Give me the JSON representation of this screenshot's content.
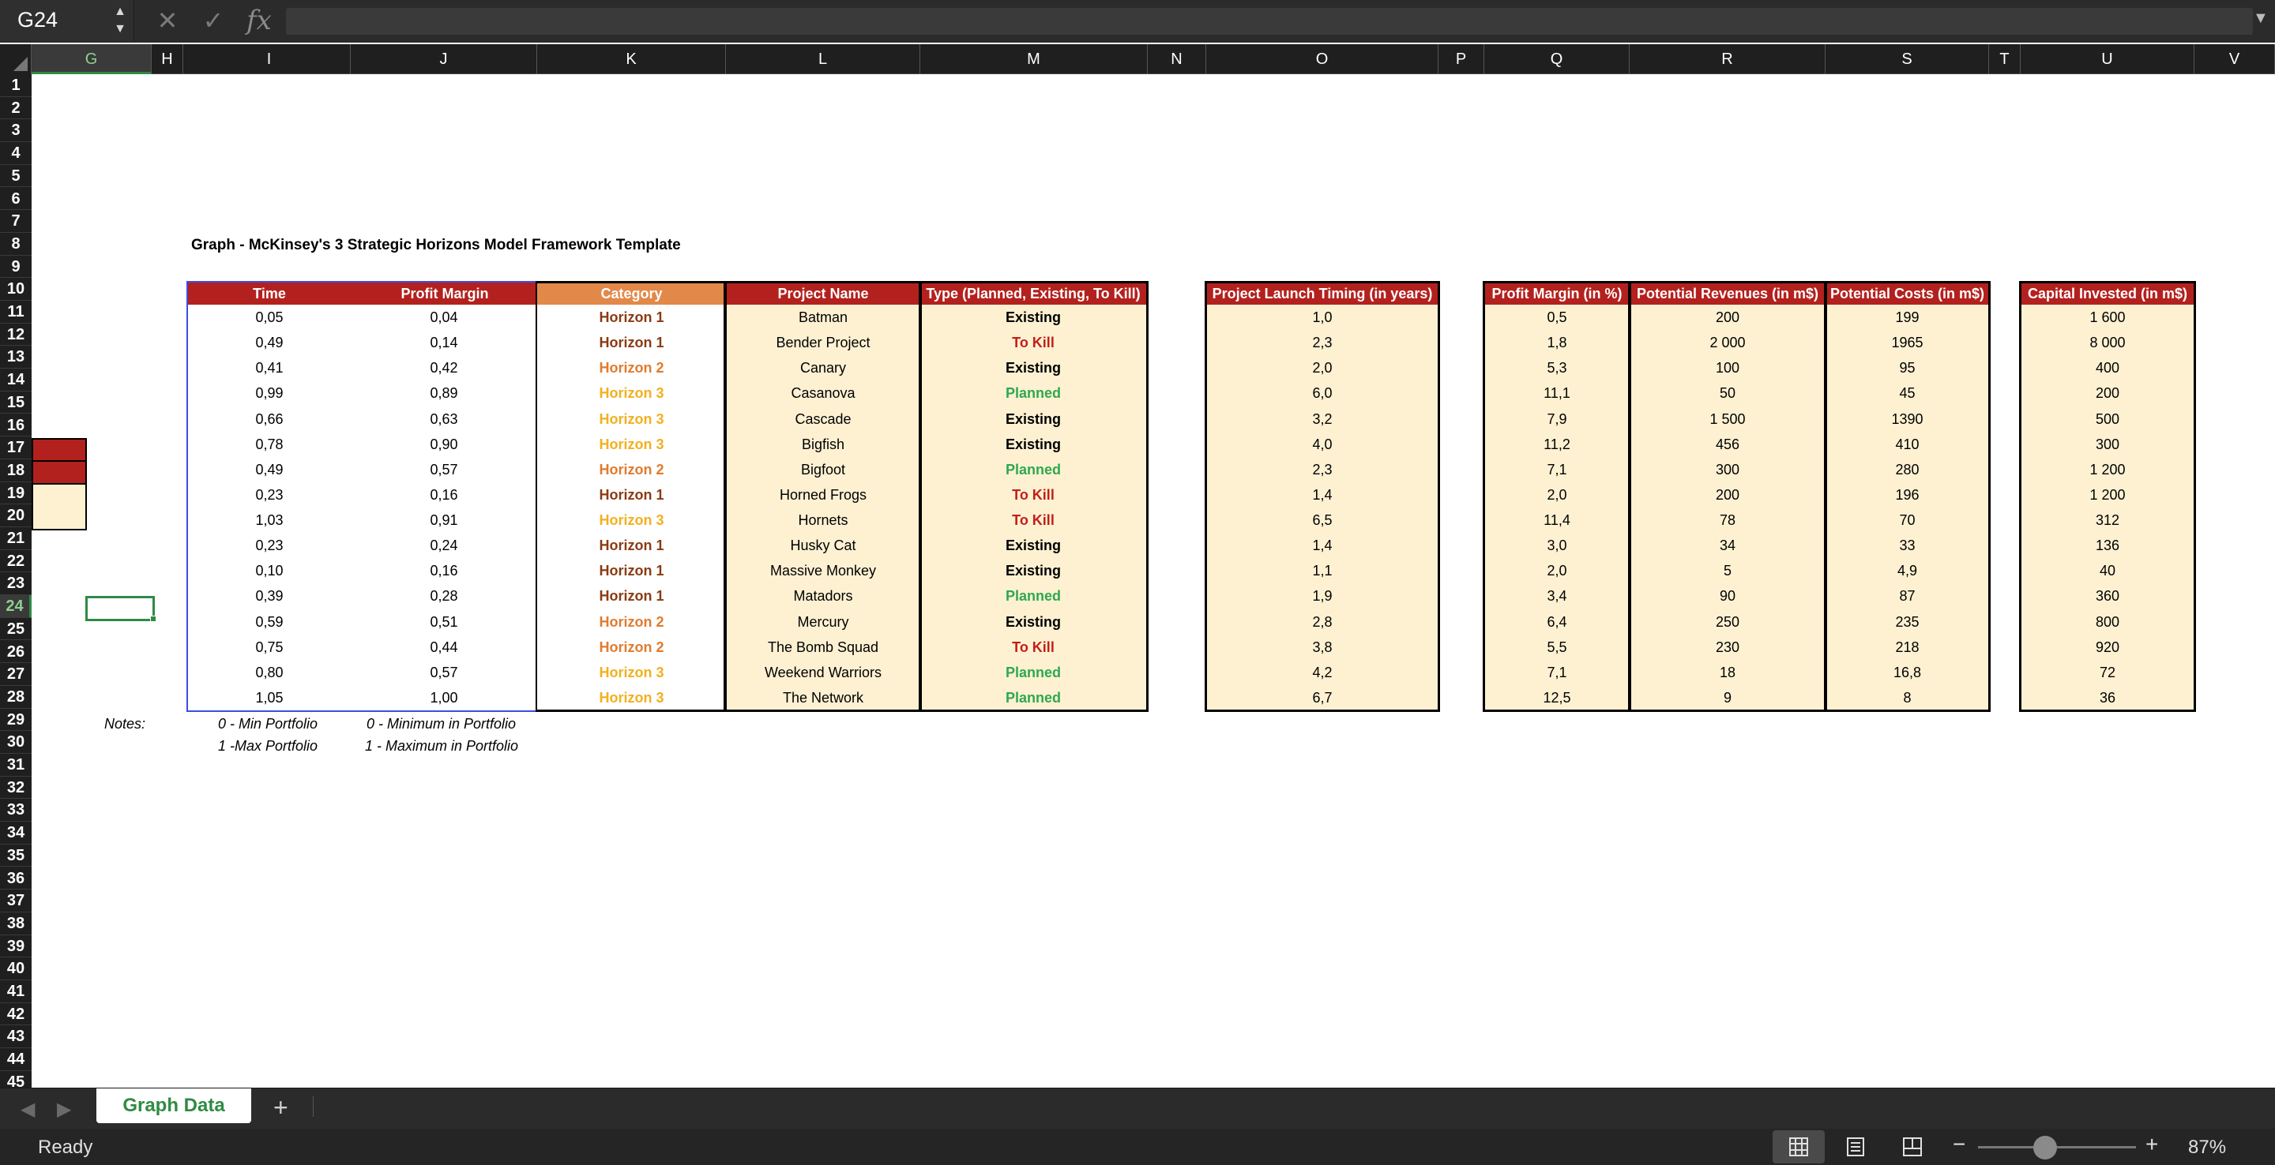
{
  "namebox": "G24",
  "formula": "",
  "colors": {
    "header_red": "#b3211e",
    "header_orange": "#e2894a",
    "beige": "#fdf1d2",
    "h1": "#8b3a12",
    "h2": "#e07b2e",
    "h3": "#f2b01e",
    "existing": "#000000",
    "tokill": "#c0201a",
    "planned": "#2fa84f",
    "accent_green": "#2f8a43"
  },
  "columns": [
    "G",
    "H",
    "I",
    "J",
    "K",
    "L",
    "M",
    "N",
    "O",
    "P",
    "Q",
    "R",
    "S",
    "T",
    "U",
    "V"
  ],
  "rows": [
    "1",
    "2",
    "3",
    "4",
    "5",
    "6",
    "7",
    "8",
    "9",
    "10",
    "11",
    "12",
    "13",
    "14",
    "15",
    "16",
    "17",
    "18",
    "19",
    "20",
    "21",
    "22",
    "23",
    "24",
    "25",
    "26",
    "27",
    "28",
    "29",
    "30",
    "31",
    "32",
    "33",
    "34",
    "35",
    "36",
    "37",
    "38",
    "39",
    "40",
    "41",
    "42",
    "43",
    "44",
    "45"
  ],
  "title": "Graph - McKinsey's 3 Strategic Horizons Model Framework Template",
  "headers": {
    "time": "Time",
    "profit_margin": "Profit Margin",
    "category": "Category",
    "project_name": "Project Name",
    "type": "Type (Planned, Existing, To Kill)",
    "launch": "Project Launch Timing (in years)",
    "pm_pct": "Profit Margin (in %)",
    "revenues": "Potential Revenues (in m$)",
    "costs": "Potential Costs (in m$)",
    "capital": "Capital Invested (in m$)"
  },
  "table": [
    {
      "time": "0,05",
      "pm": "0,04",
      "category": "Horizon 1",
      "cat": "h1",
      "name": "Batman",
      "type": "Existing",
      "tk": "existing",
      "launch": "1,0",
      "pmpct": "0,5",
      "rev": "200",
      "cost": "199",
      "cap": "1 600"
    },
    {
      "time": "0,49",
      "pm": "0,14",
      "category": "Horizon 1",
      "cat": "h1",
      "name": "Bender Project",
      "type": "To Kill",
      "tk": "tokill",
      "launch": "2,3",
      "pmpct": "1,8",
      "rev": "2 000",
      "cost": "1965",
      "cap": "8 000"
    },
    {
      "time": "0,41",
      "pm": "0,42",
      "category": "Horizon 2",
      "cat": "h2",
      "name": "Canary",
      "type": "Existing",
      "tk": "existing",
      "launch": "2,0",
      "pmpct": "5,3",
      "rev": "100",
      "cost": "95",
      "cap": "400"
    },
    {
      "time": "0,99",
      "pm": "0,89",
      "category": "Horizon 3",
      "cat": "h3",
      "name": "Casanova",
      "type": "Planned",
      "tk": "planned",
      "launch": "6,0",
      "pmpct": "11,1",
      "rev": "50",
      "cost": "45",
      "cap": "200"
    },
    {
      "time": "0,66",
      "pm": "0,63",
      "category": "Horizon 3",
      "cat": "h3",
      "name": "Cascade",
      "type": "Existing",
      "tk": "existing",
      "launch": "3,2",
      "pmpct": "7,9",
      "rev": "1 500",
      "cost": "1390",
      "cap": "500"
    },
    {
      "time": "0,78",
      "pm": "0,90",
      "category": "Horizon 3",
      "cat": "h3",
      "name": "Bigfish",
      "type": "Existing",
      "tk": "existing",
      "launch": "4,0",
      "pmpct": "11,2",
      "rev": "456",
      "cost": "410",
      "cap": "300"
    },
    {
      "time": "0,49",
      "pm": "0,57",
      "category": "Horizon 2",
      "cat": "h2",
      "name": "Bigfoot",
      "type": "Planned",
      "tk": "planned",
      "launch": "2,3",
      "pmpct": "7,1",
      "rev": "300",
      "cost": "280",
      "cap": "1 200"
    },
    {
      "time": "0,23",
      "pm": "0,16",
      "category": "Horizon 1",
      "cat": "h1",
      "name": "Horned Frogs",
      "type": "To Kill",
      "tk": "tokill",
      "launch": "1,4",
      "pmpct": "2,0",
      "rev": "200",
      "cost": "196",
      "cap": "1 200"
    },
    {
      "time": "1,03",
      "pm": "0,91",
      "category": "Horizon 3",
      "cat": "h3",
      "name": "Hornets",
      "type": "To Kill",
      "tk": "tokill",
      "launch": "6,5",
      "pmpct": "11,4",
      "rev": "78",
      "cost": "70",
      "cap": "312"
    },
    {
      "time": "0,23",
      "pm": "0,24",
      "category": "Horizon 1",
      "cat": "h1",
      "name": "Husky Cat",
      "type": "Existing",
      "tk": "existing",
      "launch": "1,4",
      "pmpct": "3,0",
      "rev": "34",
      "cost": "33",
      "cap": "136"
    },
    {
      "time": "0,10",
      "pm": "0,16",
      "category": "Horizon 1",
      "cat": "h1",
      "name": "Massive Monkey",
      "type": "Existing",
      "tk": "existing",
      "launch": "1,1",
      "pmpct": "2,0",
      "rev": "5",
      "cost": "4,9",
      "cap": "40"
    },
    {
      "time": "0,39",
      "pm": "0,28",
      "category": "Horizon 1",
      "cat": "h1",
      "name": "Matadors",
      "type": "Planned",
      "tk": "planned",
      "launch": "1,9",
      "pmpct": "3,4",
      "rev": "90",
      "cost": "87",
      "cap": "360"
    },
    {
      "time": "0,59",
      "pm": "0,51",
      "category": "Horizon 2",
      "cat": "h2",
      "name": "Mercury",
      "type": "Existing",
      "tk": "existing",
      "launch": "2,8",
      "pmpct": "6,4",
      "rev": "250",
      "cost": "235",
      "cap": "800"
    },
    {
      "time": "0,75",
      "pm": "0,44",
      "category": "Horizon 2",
      "cat": "h2",
      "name": "The Bomb Squad",
      "type": "To Kill",
      "tk": "tokill",
      "launch": "3,8",
      "pmpct": "5,5",
      "rev": "230",
      "cost": "218",
      "cap": "920"
    },
    {
      "time": "0,80",
      "pm": "0,57",
      "category": "Horizon 3",
      "cat": "h3",
      "name": "Weekend Warriors",
      "type": "Planned",
      "tk": "planned",
      "launch": "4,2",
      "pmpct": "7,1",
      "rev": "18",
      "cost": "16,8",
      "cap": "72"
    },
    {
      "time": "1,05",
      "pm": "1,00",
      "category": "Horizon 3",
      "cat": "h3",
      "name": "The Network",
      "type": "Planned",
      "tk": "planned",
      "launch": "6,7",
      "pmpct": "12,5",
      "rev": "9",
      "cost": "8",
      "cap": "36"
    }
  ],
  "notes": {
    "label": "Notes:",
    "time_min": "0 - Min Portfolio",
    "time_max": "1 -Max Portfolio",
    "pm_min": "0 - Minimum in Portfolio",
    "pm_max": "1 - Maximum in Portfolio"
  },
  "sheet_tab": "Graph Data",
  "status": "Ready",
  "zoom": "87%"
}
